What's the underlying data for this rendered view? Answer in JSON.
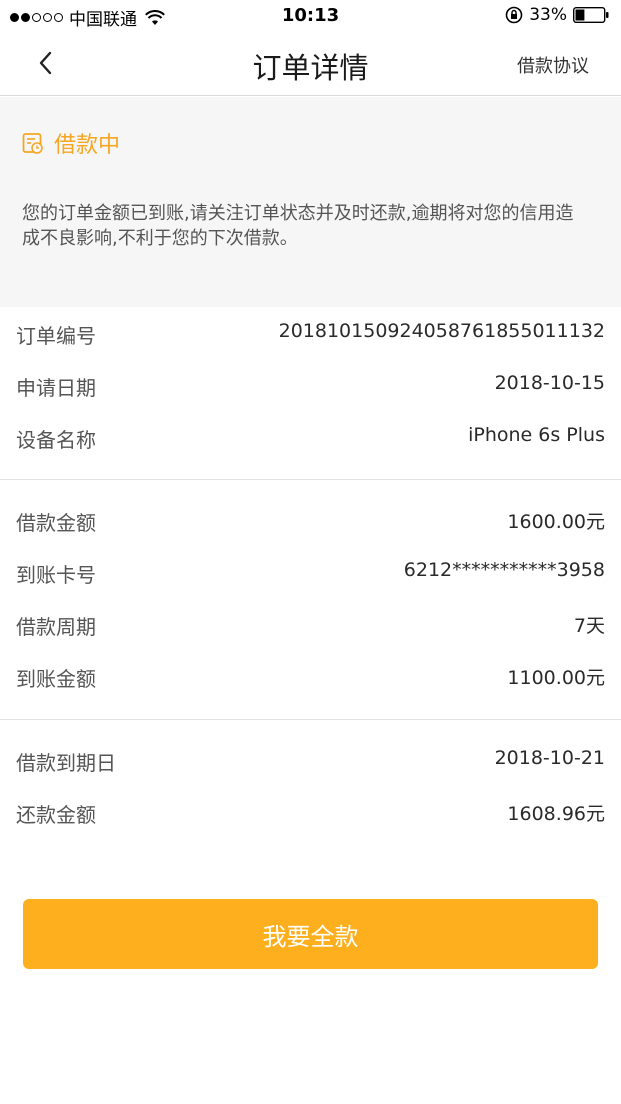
{
  "status_bar": {
    "carrier": "中国联通",
    "time": "10:13",
    "battery": "33%",
    "battery_level": 0.33
  },
  "nav": {
    "title": "订单详情",
    "right_link": "借款协议"
  },
  "banner": {
    "status": "借款中",
    "message": "您的订单金额已到账,请关注订单状态并及时还款,逾期将对您的信用造成不良影响,不利于您的下次借款。",
    "accent_color": "#f5a623"
  },
  "details": {
    "order_info": [
      {
        "label": "订单编号",
        "value": "20181015092405876185501113​2"
      },
      {
        "label": "申请日期",
        "value": "2018-10-15"
      },
      {
        "label": "设备名称",
        "value": "iPhone 6s Plus"
      }
    ],
    "loan_info": [
      {
        "label": "借款金额",
        "value": "1600.00元"
      },
      {
        "label": "到账卡号",
        "value": "6212***********3958"
      },
      {
        "label": "借款周期",
        "value": "7天"
      },
      {
        "label": "到账金额",
        "value": "1100.00元"
      }
    ],
    "repay_info": [
      {
        "label": "借款到期日",
        "value": "2018-10-21"
      },
      {
        "label": "还款金额",
        "value": "1608.96元"
      }
    ]
  },
  "action": {
    "button_label": "我要全款",
    "button_color": "#fdaf1e"
  }
}
